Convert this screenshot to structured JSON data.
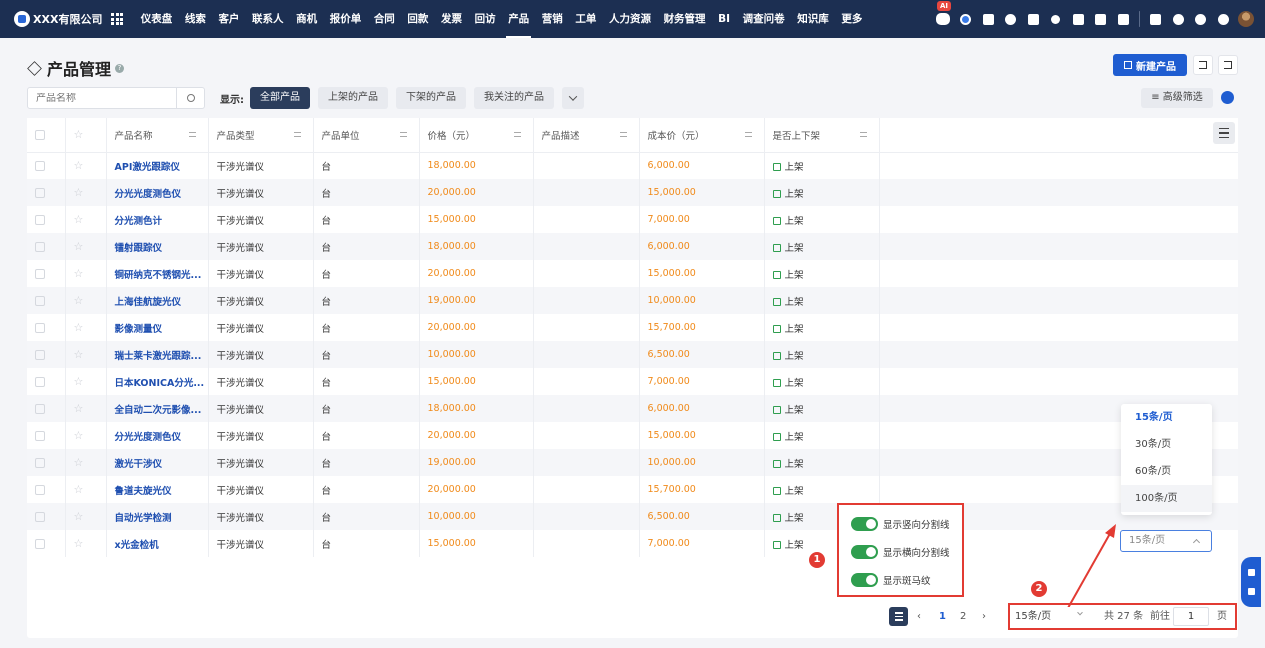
{
  "nav": {
    "brand": "XXX有限公司",
    "items": [
      "仪表盘",
      "线索",
      "客户",
      "联系人",
      "商机",
      "报价单",
      "合同",
      "回款",
      "发票",
      "回访",
      "产品",
      "营销",
      "工单",
      "人力资源",
      "财务管理",
      "BI",
      "调查问卷",
      "知识库",
      "更多"
    ],
    "active_index": 10,
    "ai_badge": "AI"
  },
  "page": {
    "title": "产品管理",
    "new_button": "新建产品"
  },
  "filter": {
    "search_placeholder": "产品名称",
    "show_label": "显示:",
    "tabs": [
      "全部产品",
      "上架的产品",
      "下架的产品",
      "我关注的产品"
    ],
    "active_tab": 0,
    "advanced": "高级筛选"
  },
  "table": {
    "columns": [
      "产品名称",
      "产品类型",
      "产品单位",
      "价格（元）",
      "产品描述",
      "成本价（元）",
      "是否上下架"
    ],
    "rows": [
      {
        "name": "API激光跟踪仪",
        "type": "干涉光谱仪",
        "unit": "台",
        "price": "18,000.00",
        "desc": "",
        "cost": "6,000.00",
        "status": "上架"
      },
      {
        "name": "分光光度测色仪",
        "type": "干涉光谱仪",
        "unit": "台",
        "price": "20,000.00",
        "desc": "",
        "cost": "15,000.00",
        "status": "上架"
      },
      {
        "name": "分光测色计",
        "type": "干涉光谱仪",
        "unit": "台",
        "price": "15,000.00",
        "desc": "",
        "cost": "7,000.00",
        "status": "上架"
      },
      {
        "name": "镭射跟踪仪",
        "type": "干涉光谱仪",
        "unit": "台",
        "price": "18,000.00",
        "desc": "",
        "cost": "6,000.00",
        "status": "上架"
      },
      {
        "name": "铜研纳克不锈钢光...",
        "type": "干涉光谱仪",
        "unit": "台",
        "price": "20,000.00",
        "desc": "",
        "cost": "15,000.00",
        "status": "上架"
      },
      {
        "name": "上海佳航旋光仪",
        "type": "干涉光谱仪",
        "unit": "台",
        "price": "19,000.00",
        "desc": "",
        "cost": "10,000.00",
        "status": "上架"
      },
      {
        "name": "影像测量仪",
        "type": "干涉光谱仪",
        "unit": "台",
        "price": "20,000.00",
        "desc": "",
        "cost": "15,700.00",
        "status": "上架"
      },
      {
        "name": "瑞士莱卡激光跟踪...",
        "type": "干涉光谱仪",
        "unit": "台",
        "price": "10,000.00",
        "desc": "",
        "cost": "6,500.00",
        "status": "上架"
      },
      {
        "name": "日本KONICA分光...",
        "type": "干涉光谱仪",
        "unit": "台",
        "price": "15,000.00",
        "desc": "",
        "cost": "7,000.00",
        "status": "上架"
      },
      {
        "name": "全自动二次元影像...",
        "type": "干涉光谱仪",
        "unit": "台",
        "price": "18,000.00",
        "desc": "",
        "cost": "6,000.00",
        "status": "上架"
      },
      {
        "name": "分光光度测色仪",
        "type": "干涉光谱仪",
        "unit": "台",
        "price": "20,000.00",
        "desc": "",
        "cost": "15,000.00",
        "status": "上架"
      },
      {
        "name": "激光干涉仪",
        "type": "干涉光谱仪",
        "unit": "台",
        "price": "19,000.00",
        "desc": "",
        "cost": "10,000.00",
        "status": "上架"
      },
      {
        "name": "鲁道夫旋光仪",
        "type": "干涉光谱仪",
        "unit": "台",
        "price": "20,000.00",
        "desc": "",
        "cost": "15,700.00",
        "status": "上架"
      },
      {
        "name": "自动光学检测",
        "type": "干涉光谱仪",
        "unit": "台",
        "price": "10,000.00",
        "desc": "",
        "cost": "6,500.00",
        "status": "上架"
      },
      {
        "name": "x光金检机",
        "type": "干涉光谱仪",
        "unit": "台",
        "price": "15,000.00",
        "desc": "",
        "cost": "7,000.00",
        "status": "上架"
      }
    ]
  },
  "toggles": [
    "显示竖向分割线",
    "显示横向分割线",
    "显示斑马纹"
  ],
  "annotations": {
    "badge1": "1",
    "badge2": "2"
  },
  "page_size_menu": {
    "options": [
      "15条/页",
      "30条/页",
      "60条/页",
      "100条/页"
    ],
    "selected": "15条/页",
    "current_placeholder": "15条/页"
  },
  "pagination": {
    "pages": [
      "1",
      "2"
    ],
    "active_page": "1",
    "page_size": "15条/页",
    "total": "共 27 条",
    "goto_label": "前往",
    "goto_value": "1",
    "page_suffix": "页"
  },
  "colors": {
    "nav_bg": "#1c2f52",
    "accent": "#1f5dd1",
    "price": "#f08a1a",
    "highlight": "#e23b33",
    "toggle_on": "#2f9e4f"
  }
}
